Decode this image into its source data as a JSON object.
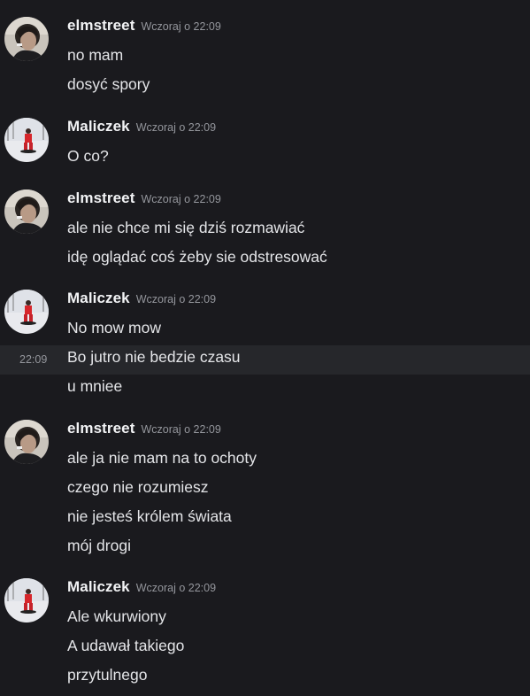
{
  "groups": [
    {
      "author": "elmstreet",
      "avatar": "elmstreet-avatar",
      "timestamp": "Wczoraj o 22:09",
      "lines": [
        "no mam",
        "dosyć spory"
      ]
    },
    {
      "author": "Maliczek",
      "avatar": "maliczek-avatar",
      "timestamp": "Wczoraj o 22:09",
      "lines": [
        "O co?"
      ]
    },
    {
      "author": "elmstreet",
      "avatar": "elmstreet-avatar",
      "timestamp": "Wczoraj o 22:09",
      "lines": [
        "ale nie chce mi się dziś rozmawiać",
        "idę oglądać coś żeby sie odstresować"
      ]
    },
    {
      "author": "Maliczek",
      "avatar": "maliczek-avatar",
      "timestamp": "Wczoraj o 22:09",
      "lines": [
        "No mow mow",
        "Bo jutro nie bedzie czasu",
        "u mniee"
      ],
      "hovered_line": {
        "index": 1,
        "time": "22:09"
      }
    },
    {
      "author": "elmstreet",
      "avatar": "elmstreet-avatar",
      "timestamp": "Wczoraj o 22:09",
      "lines": [
        "ale ja nie mam na to ochoty",
        "czego nie rozumiesz",
        "nie jesteś królem świata",
        "mój drogi"
      ]
    },
    {
      "author": "Maliczek",
      "avatar": "maliczek-avatar",
      "timestamp": "Wczoraj o 22:09",
      "lines": [
        "Ale wkurwiony",
        "A udawał takiego",
        "przytulnego"
      ]
    }
  ],
  "colors": {
    "background": "#1a1a1e",
    "hover_background": "#26272b",
    "username": "#f2f3f5",
    "message_text": "#e4e5e8",
    "timestamp": "#94969c"
  }
}
